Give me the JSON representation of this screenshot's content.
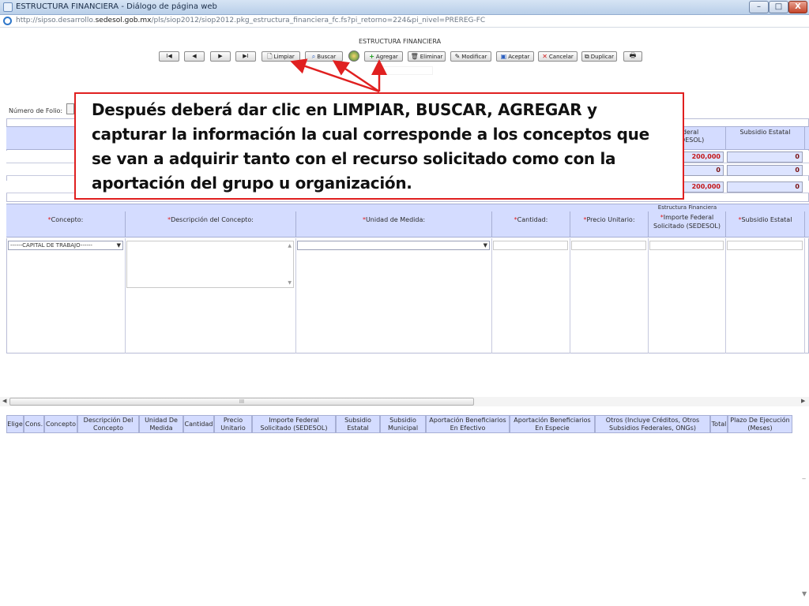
{
  "window": {
    "title": "ESTRUCTURA FINANCIERA - Diálogo de página web",
    "minimize_glyph": "–",
    "maximize_glyph": "□",
    "close_glyph": "X"
  },
  "address": {
    "url_prefix": "http://sipso.desarrollo.",
    "url_domain": "sedesol.gob.mx",
    "url_path": "/pls/siop2012/siop2012.pkg_estructura_financiera_fc.fs?pi_retorno=224&pi_nivel=PREREG-FC"
  },
  "page": {
    "title": "ESTRUCTURA FINANCIERA"
  },
  "toolbar": {
    "first": "I◀",
    "prev": "◀",
    "next": "▶",
    "last": "▶I",
    "limpiar": "Limpiar",
    "buscar": "Buscar",
    "agregar": "Agregar",
    "eliminar": "Eliminar",
    "modificar": "Modificar",
    "aceptar": "Aceptar",
    "cancelar": "Cancelar",
    "duplicar": "Duplicar",
    "print_glyph": "🖶"
  },
  "folio": {
    "label": "Número de Folio:"
  },
  "summary": {
    "col_federal": "Federal\n(SEDESOL)",
    "col_federal_partial": "Federal",
    "col_federal_partial2": "(SEDESOL)",
    "col_estatal": "Subsidio Estatal",
    "rows": [
      {
        "federal": "200,000",
        "estatal": "0"
      },
      {
        "federal": "0",
        "estatal": "0"
      },
      {
        "federal": "200,000",
        "estatal": "0"
      }
    ]
  },
  "estructura": {
    "strip_label": "Estructura Financiera",
    "req_mark": "*",
    "headers": {
      "concepto": "Concepto:",
      "descripcion": "Descripción del Concepto:",
      "unidad": "Unidad de Medida:",
      "cantidad": "Cantidad:",
      "precio": "Precio Unitario:",
      "importe_1": "Importe Federal",
      "importe_2": "Solicitado (SEDESOL)",
      "subsidio": "Subsidio Estatal"
    },
    "concepto_value": "------CAPITAL DE TRABAJO------",
    "dropdown_arrow": "▼"
  },
  "hscroll": {
    "grip": "III"
  },
  "bottom_table": {
    "headers": [
      "Elige",
      "Cons.",
      "Concepto",
      "Descripción Del Concepto",
      "Unidad De Medida",
      "Cantidad",
      "Precio Unitario",
      "Importe Federal Solicitado (SEDESOL)",
      "Subsidio Estatal",
      "Subsidio Municipal",
      "Aportación Beneficiarios En Efectivo",
      "Aportación Beneficiarios En Especie",
      "Otros (Incluye Créditos, Otros Subsidios Federales, ONGs)",
      "Total",
      "Plazo De Ejecución (Meses)"
    ]
  },
  "callout": {
    "p1": "Después deberá dar clic en ",
    "k1": "LIMPIAR",
    "s1": ", ",
    "k2": "BUSCAR",
    "s2": ",  ",
    "k3": "AGREGAR",
    "p2": " y capturar la información la cual corresponde a los conceptos que se van a adquirir tanto con el recurso solicitado como con la aportación del grupo u organización."
  },
  "colors": {
    "header_bg": "#d4dcff",
    "accent_red": "#e02020",
    "value_red": "#c21616"
  }
}
